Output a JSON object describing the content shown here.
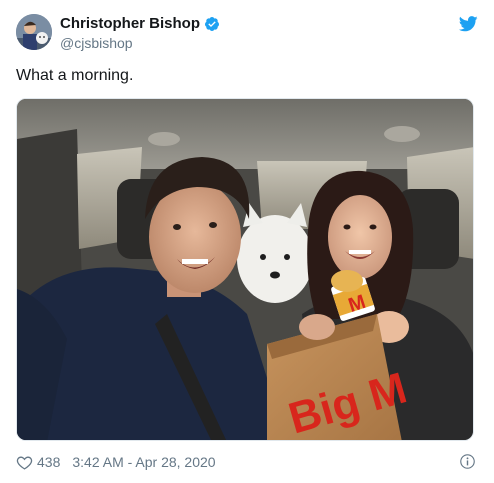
{
  "tweet": {
    "display_name": "Christopher Bishop",
    "handle": "@cjsbishop",
    "verified": true,
    "text": "What a morning.",
    "likes": "438",
    "timestamp": "3:42 AM - Apr 28, 2020"
  },
  "photo": {
    "bag_text": "Big M"
  },
  "icons": {
    "verified": "verified-badge-icon",
    "brand": "twitter-bird-icon",
    "like": "heart-icon",
    "info": "info-icon"
  },
  "colors": {
    "brand_blue": "#1da1f2",
    "muted_text": "#657786",
    "primary_text": "#14171a",
    "mcd_red": "#d8261c",
    "mcd_yellow": "#f5c300"
  }
}
